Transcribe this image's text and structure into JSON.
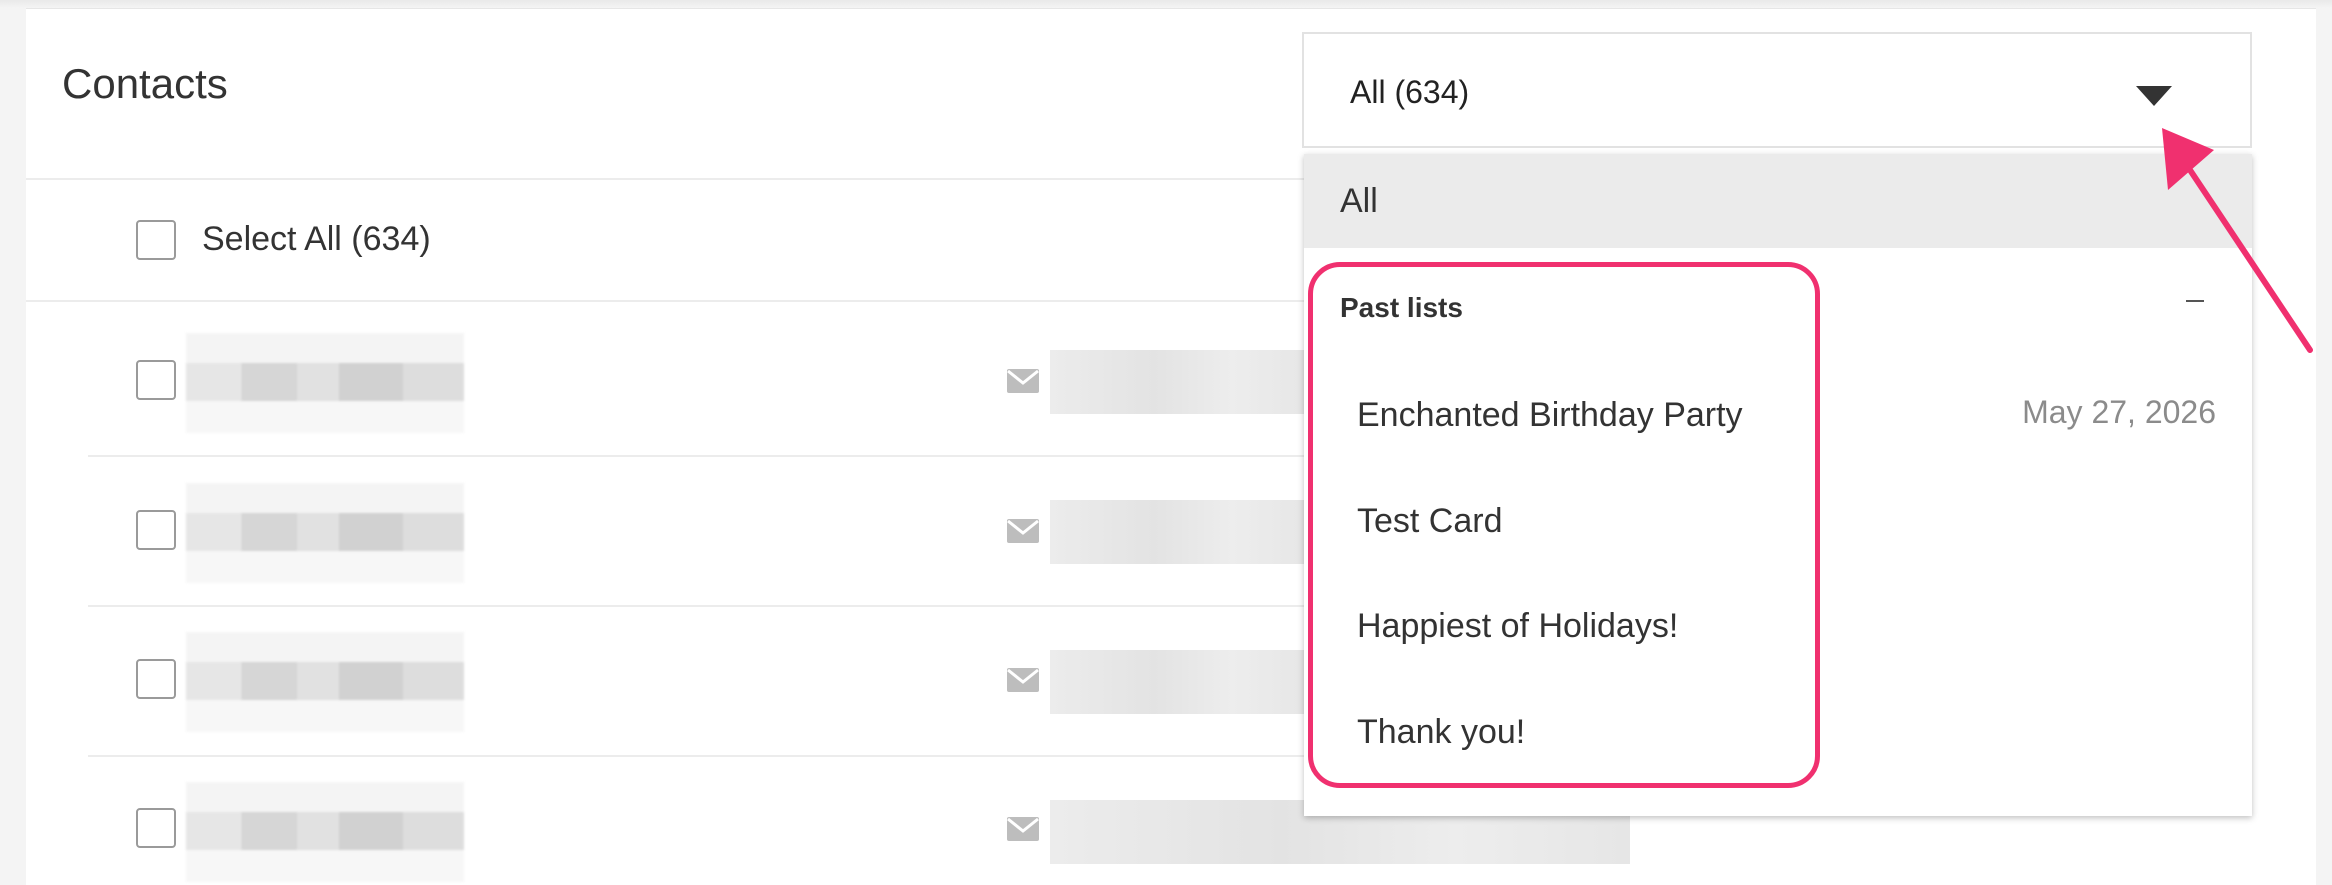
{
  "header": {
    "title": "Contacts"
  },
  "list_controls": {
    "select_all_label": "Select All (634)"
  },
  "filter_select": {
    "value": "All (634)",
    "options": [
      {
        "label": "All",
        "highlighted": true
      }
    ],
    "group": {
      "label": "Past lists",
      "items": [
        {
          "label": "Enchanted Birthday Party",
          "date": "May 27, 2026"
        },
        {
          "label": "Test Card",
          "date": ""
        },
        {
          "label": "Happiest of Holidays!",
          "date": ""
        },
        {
          "label": "Thank you!",
          "date": ""
        }
      ]
    }
  },
  "annotation": {
    "color": "#f0306f"
  },
  "contacts_rows": [
    {
      "name": "",
      "email": ""
    },
    {
      "name": "",
      "email": ""
    },
    {
      "name": "",
      "email": ""
    },
    {
      "name": "",
      "email": ""
    }
  ]
}
